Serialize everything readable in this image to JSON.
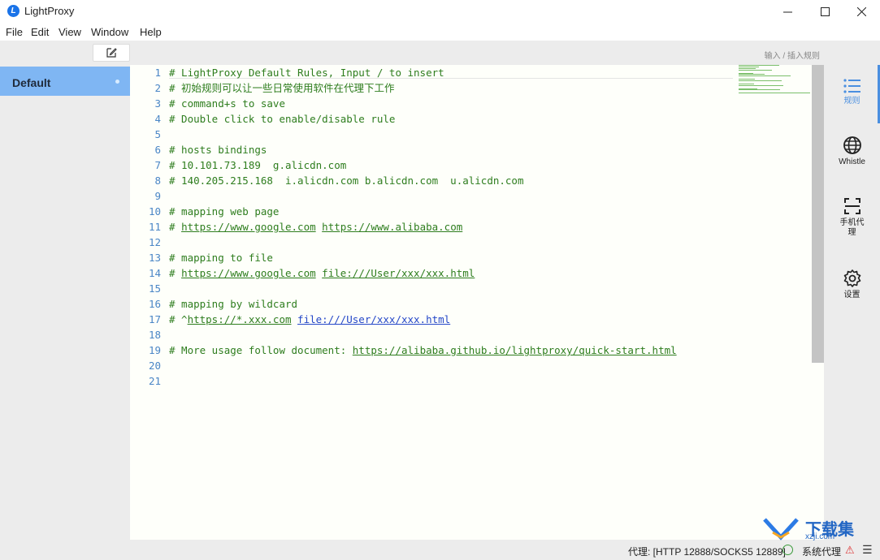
{
  "window": {
    "title": "LightProxy",
    "app_icon_letter": "L"
  },
  "menu": {
    "items": [
      "File",
      "Edit",
      "View",
      "Window",
      "Help"
    ]
  },
  "toolbar": {
    "hint": "输入 / 插入规则"
  },
  "sidebar": {
    "items": [
      {
        "label": "Default",
        "active": true
      }
    ]
  },
  "editor": {
    "lines": [
      {
        "no": "1",
        "text": "# LightProxy Default Rules, Input / to insert"
      },
      {
        "no": "2",
        "text": "# 初始规则可以让一些日常使用软件在代理下工作"
      },
      {
        "no": "3",
        "text": "# command+s to save"
      },
      {
        "no": "4",
        "text": "# Double click to enable/disable rule"
      },
      {
        "no": "5",
        "text": ""
      },
      {
        "no": "6",
        "text": "# hosts bindings"
      },
      {
        "no": "7",
        "text": "# 10.101.73.189  g.alicdn.com"
      },
      {
        "no": "8",
        "text": "# 140.205.215.168  i.alicdn.com b.alicdn.com  u.alicdn.com"
      },
      {
        "no": "9",
        "text": ""
      },
      {
        "no": "10",
        "text": "# mapping web page"
      },
      {
        "no": "11",
        "prefix": "# ",
        "link1": "https://www.google.com",
        "mid": " ",
        "link2": "https://www.alibaba.com"
      },
      {
        "no": "12",
        "text": ""
      },
      {
        "no": "13",
        "text": "# mapping to file"
      },
      {
        "no": "14",
        "prefix": "# ",
        "link1": "https://www.google.com",
        "mid": " ",
        "link2": "file:///User/xxx/xxx.html"
      },
      {
        "no": "15",
        "text": ""
      },
      {
        "no": "16",
        "text": "# mapping by wildcard"
      },
      {
        "no": "17",
        "prefix": "# ^",
        "link1": "https://*.xxx.com",
        "mid": " ",
        "link2_blue": "file:///User/xxx/xxx.html"
      },
      {
        "no": "18",
        "text": ""
      },
      {
        "no": "19",
        "prefix": "# More usage follow document: ",
        "link1": "https://alibaba.github.io/lightproxy/quick-start.html"
      },
      {
        "no": "20",
        "text": ""
      },
      {
        "no": "21",
        "text": ""
      }
    ]
  },
  "rightnav": {
    "items": [
      {
        "icon": "list-icon",
        "label": "规则",
        "active": true
      },
      {
        "icon": "globe-icon",
        "label": "Whistle"
      },
      {
        "icon": "scan-icon",
        "label": "手机代理"
      },
      {
        "icon": "gear-icon",
        "label": "设置"
      }
    ]
  },
  "status": {
    "proxy": "代理: [HTTP 12888/SOCKS5 12889]",
    "system": "系统代理"
  },
  "watermark": {
    "text": "下载集",
    "sub": "xzji.com"
  },
  "colors": {
    "accent": "#4a8fe0",
    "active_item": "#7fb6f3",
    "comment": "#2e7d1e",
    "line_number": "#4a86c6"
  }
}
